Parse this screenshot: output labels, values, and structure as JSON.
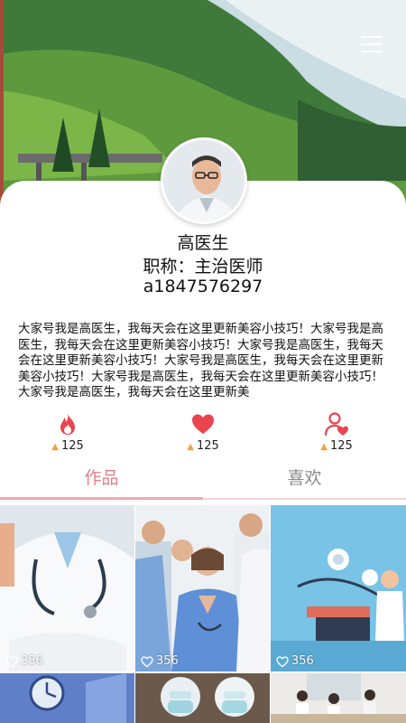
{
  "profile": {
    "name": "高医生",
    "title": "职称：主治医师",
    "account": "a1847576297",
    "bio": "大家号我是高医生，我每天会在这里更新美容小技巧！大家号我是高医生，我每天会在这里更新美容小技巧！大家号我是高医生，我每天会在这里更新美容小技巧！大家号我是高医生，我每天会在这里更新美容小技巧！大家号我是高医生，我每天会在这里更新美容小技巧！大家号我是高医生，我每天会在这里更新美"
  },
  "stats": [
    {
      "icon": "fire-icon",
      "count": "125"
    },
    {
      "icon": "heart-icon",
      "count": "125"
    },
    {
      "icon": "user-heart-icon",
      "count": "125"
    }
  ],
  "tabs": [
    {
      "label": "作品",
      "active": true
    },
    {
      "label": "喜欢",
      "active": false
    }
  ],
  "grid": [
    {
      "likes": "356",
      "desc": "doctor with stethoscope"
    },
    {
      "likes": "356",
      "desc": "medical team"
    },
    {
      "likes": "356",
      "desc": "medical illustration"
    },
    {
      "likes": "",
      "desc": "clock illustration"
    },
    {
      "likes": "",
      "desc": "doctors in masks"
    },
    {
      "likes": "",
      "desc": "meeting room"
    }
  ],
  "colors": {
    "accent": "#e2808c",
    "heart": "#e9454f",
    "up_arrow": "#f0a046"
  }
}
